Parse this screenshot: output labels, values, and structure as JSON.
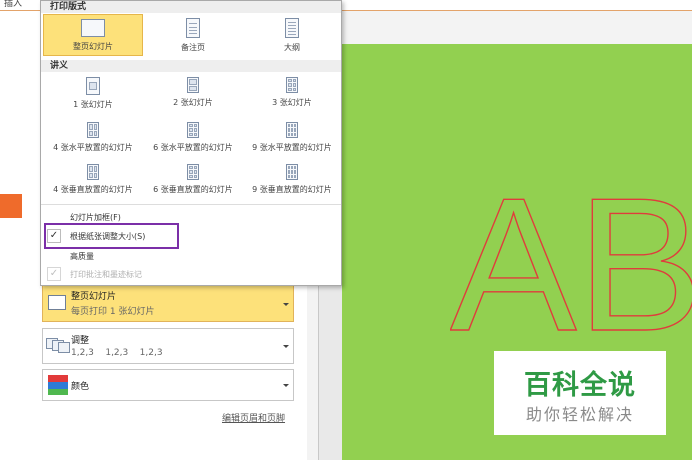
{
  "top_strip": {
    "left_text": "插入"
  },
  "popup": {
    "print_layout": {
      "header": "打印版式",
      "options": [
        {
          "label": "整页幻灯片",
          "selected": true
        },
        {
          "label": "备注页",
          "selected": false
        },
        {
          "label": "大纲",
          "selected": false
        }
      ]
    },
    "handouts": {
      "header": "讲义",
      "options": [
        {
          "label": "1 张幻灯片"
        },
        {
          "label": "2 张幻灯片"
        },
        {
          "label": "3 张幻灯片"
        },
        {
          "label": "4 张水平放置的幻灯片"
        },
        {
          "label": "6 张水平放置的幻灯片"
        },
        {
          "label": "9 张水平放置的幻灯片"
        },
        {
          "label": "4 张垂直放置的幻灯片"
        },
        {
          "label": "6 张垂直放置的幻灯片"
        },
        {
          "label": "9 张垂直放置的幻灯片"
        }
      ]
    },
    "checks": [
      {
        "label": "幻灯片加框(F)",
        "checked": false,
        "enabled": true
      },
      {
        "label": "根据纸张调整大小(S)",
        "checked": true,
        "enabled": true
      },
      {
        "label": "高质量",
        "checked": false,
        "enabled": true
      },
      {
        "label": "打印批注和墨迹标记",
        "checked": true,
        "enabled": false
      }
    ]
  },
  "settings": {
    "layout": {
      "title": "整页幻灯片",
      "subtitle": "每页打印 1 张幻灯片"
    },
    "collation": {
      "title": "调整",
      "subtitle": "1,2,3    1,2,3    1,2,3"
    },
    "color": {
      "title": "颜色"
    },
    "footer_link": "编辑页眉和页脚"
  },
  "slide": {
    "outline_text": "AB",
    "background_color": "#92d050",
    "outline_color": "#e03c3c"
  },
  "watermark": {
    "title": "百科全说",
    "subtitle": "助你轻松解决"
  }
}
